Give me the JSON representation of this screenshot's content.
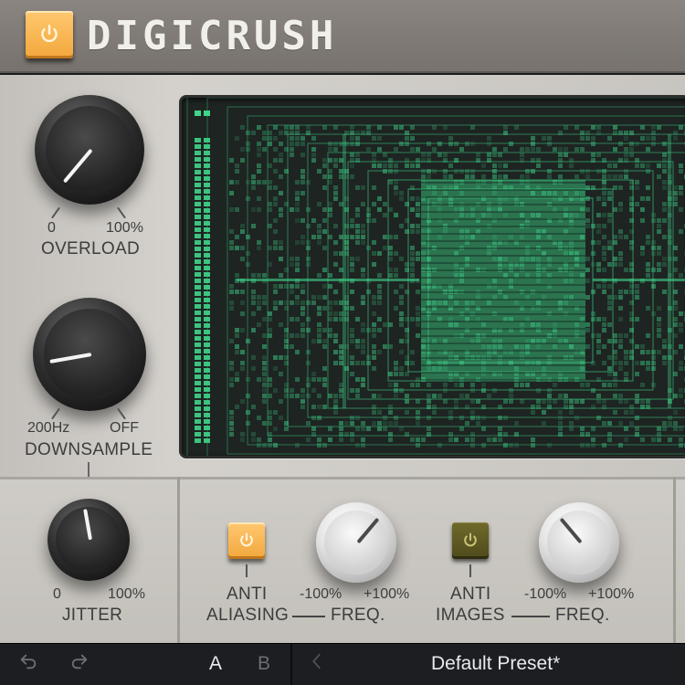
{
  "plugin": {
    "title": "DIGICRUSH",
    "power_on": true
  },
  "knobs": {
    "overload": {
      "label": "OVERLOAD",
      "min_label": "0",
      "max_label": "100%"
    },
    "downsample": {
      "label": "DOWNSAMPLE",
      "min_label": "200Hz",
      "max_label": "OFF"
    },
    "jitter": {
      "label": "JITTER",
      "min_label": "0",
      "max_label": "100%"
    },
    "anti_aliasing_freq": {
      "label": "FREQ.",
      "min_label": "-100%",
      "max_label": "+100%"
    },
    "anti_images_freq": {
      "label": "FREQ.",
      "min_label": "-100%",
      "max_label": "+100%"
    }
  },
  "toggles": {
    "anti_aliasing": {
      "line1": "ANTI",
      "line2": "ALIASING",
      "on": true
    },
    "anti_images": {
      "line1": "ANTI",
      "line2": "IMAGES",
      "on": false
    }
  },
  "footer": {
    "undo_icon": "undo-icon",
    "redo_icon": "redo-icon",
    "slot_a": "A",
    "slot_b": "B",
    "prev_icon": "chevron-left-icon",
    "preset_name": "Default Preset*"
  },
  "colors": {
    "accent_orange": "#f2a73c",
    "display_green": "#3fd58a",
    "display_bg": "#1e2422"
  }
}
